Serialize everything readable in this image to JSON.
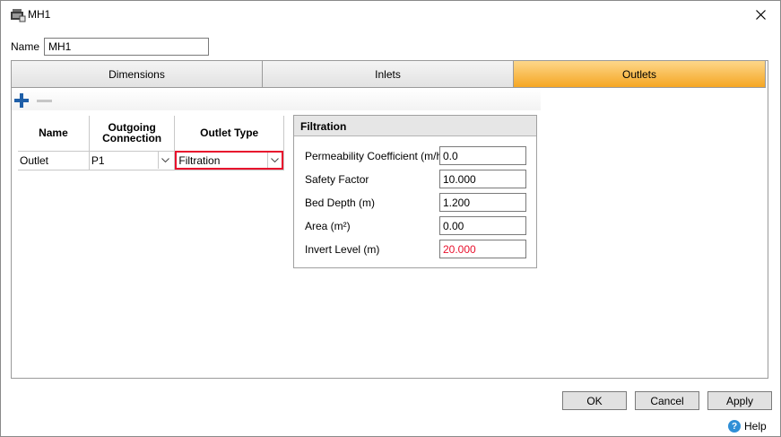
{
  "window": {
    "title": "MH1"
  },
  "name_field": {
    "label": "Name",
    "value": "MH1"
  },
  "tabs": [
    {
      "label": "Dimensions"
    },
    {
      "label": "Inlets"
    },
    {
      "label": "Outlets",
      "active": true
    }
  ],
  "toolbar": {
    "add_icon": "plus-icon",
    "remove_icon": "minus-icon"
  },
  "grid": {
    "headers": {
      "name": "Name",
      "outgoing": "Outgoing Connection",
      "type": "Outlet Type"
    },
    "rows": [
      {
        "name": "Outlet",
        "outgoing": "P1",
        "type": "Filtration"
      }
    ]
  },
  "filtration": {
    "title": "Filtration",
    "fields": [
      {
        "label": "Permeability Coefficient (m/hr)",
        "value": "0.0"
      },
      {
        "label": "Safety Factor",
        "value": "10.000"
      },
      {
        "label": "Bed Depth (m)",
        "value": "1.200"
      },
      {
        "label": "Area (m²)",
        "value": "0.00"
      },
      {
        "label": "Invert Level (m)",
        "value": "20.000",
        "error": true
      }
    ]
  },
  "buttons": {
    "ok": "OK",
    "cancel": "Cancel",
    "apply": "Apply"
  },
  "help": {
    "label": "Help"
  },
  "colors": {
    "active_tab": "#f5a623",
    "error": "#e8112d",
    "accent_blue": "#1f5fa8"
  }
}
